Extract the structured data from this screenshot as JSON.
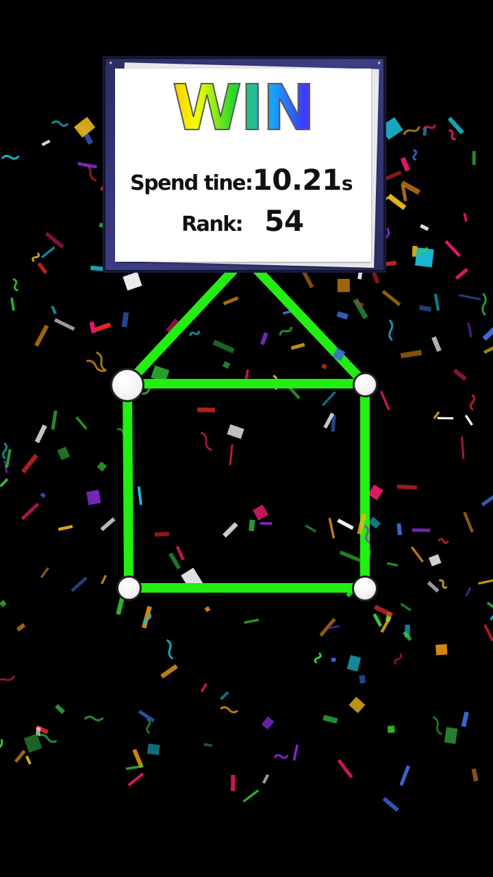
{
  "result": {
    "title": "WIN",
    "time_label": "Spend tine:",
    "time_value": "10.21",
    "time_unit": "s",
    "rank_label": "Rank:",
    "rank_value": "54"
  },
  "puzzle": {
    "shape": "house",
    "line_color": "#22ee11",
    "nodes": [
      "top-left",
      "top-right",
      "bottom-left",
      "bottom-right"
    ],
    "edges_completed": 6,
    "edges_total": 6
  },
  "confetti_colors": [
    "#e8b81a",
    "#d88a14",
    "#2b9b3a",
    "#3ad83a",
    "#3a6bd8",
    "#8a2bd8",
    "#e01a6a",
    "#e02a2a",
    "#ffffff",
    "#1ac0d8"
  ]
}
